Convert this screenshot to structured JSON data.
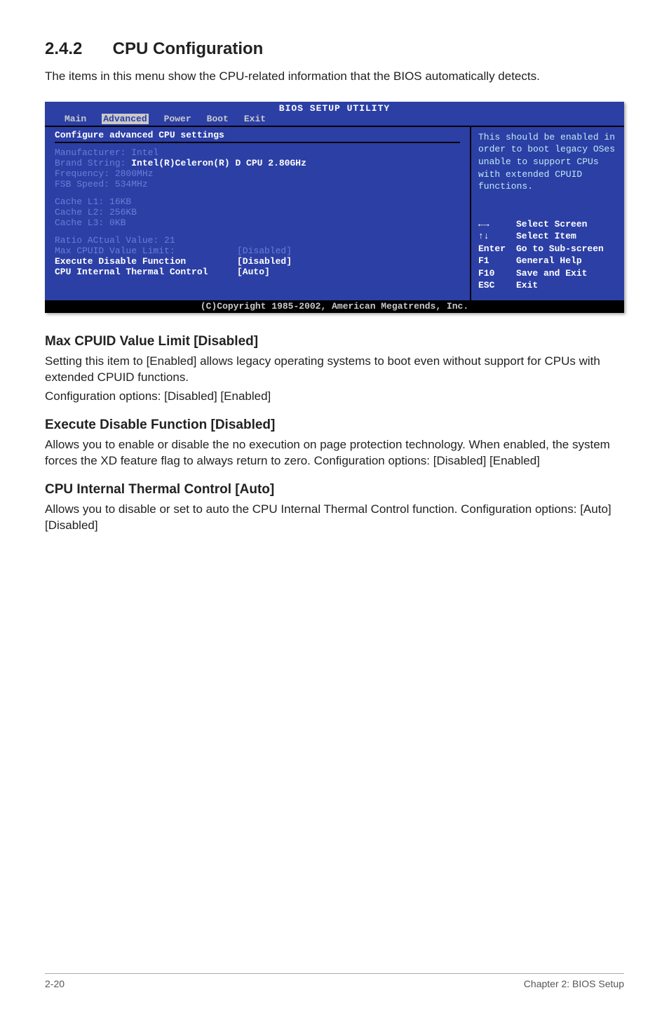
{
  "section": {
    "number": "2.4.2",
    "title": "CPU Configuration",
    "intro": "The items in this menu show the CPU-related information that the BIOS automatically detects."
  },
  "bios": {
    "header": "BIOS SETUP UTILITY",
    "tabs": [
      "Main",
      "Advanced",
      "Power",
      "Boot",
      "Exit"
    ],
    "active_tab": "Advanced",
    "left": {
      "heading": "Configure advanced CPU settings",
      "info": {
        "manufacturer": "Manufacturer: Intel",
        "brand_label": "Brand String:",
        "brand_value": "Intel(R)Celeron(R) D CPU 2.80GHz",
        "frequency": "Frequency: 2800MHz",
        "fsb": "FSB Speed: 534MHz",
        "cache_l1": "Cache L1: 16KB",
        "cache_l2": "Cache L2: 256KB",
        "cache_l3": "Cache L3: 0KB",
        "ratio": "Ratio ACtual Value: 21"
      },
      "rows": [
        {
          "k": "Max CPUID Value Limit:",
          "v": "[Disabled]",
          "style": "dim"
        },
        {
          "k": "Execute Disable Function",
          "v": "[Disabled]",
          "style": "wht"
        },
        {
          "k": "CPU Internal Thermal Control",
          "v": "[Auto]",
          "style": "wht"
        }
      ]
    },
    "right": {
      "help": "This should be enabled in order to boot legacy OSes unable to support CPUs with extended CPUID functions.",
      "keys": [
        {
          "a": "←→",
          "b": "Select Screen"
        },
        {
          "a": "↑↓",
          "b": "Select Item"
        },
        {
          "a": "Enter",
          "b": "Go to Sub-screen"
        },
        {
          "a": "F1",
          "b": "General Help"
        },
        {
          "a": "F10",
          "b": "Save and Exit"
        },
        {
          "a": "ESC",
          "b": "Exit"
        }
      ]
    },
    "footer": "(C)Copyright 1985-2002, American Megatrends, Inc."
  },
  "subsections": [
    {
      "title": "Max CPUID Value Limit [Disabled]",
      "body1": "Setting this item to [Enabled] allows legacy operating systems to boot even without support for CPUs with extended CPUID functions.",
      "body2": "Configuration options: [Disabled] [Enabled]"
    },
    {
      "title": "Execute Disable Function [Disabled]",
      "body1": "Allows you to enable or disable the no execution on page protection technology. When enabled, the system forces the XD feature flag to always return to zero. Configuration options: [Disabled] [Enabled]",
      "body2": ""
    },
    {
      "title": "CPU Internal Thermal Control [Auto]",
      "body1": "Allows you to disable or set to auto the CPU Internal Thermal Control function. Configuration options: [Auto] [Disabled]",
      "body2": ""
    }
  ],
  "footer": {
    "left": "2-20",
    "right": "Chapter 2: BIOS Setup"
  }
}
